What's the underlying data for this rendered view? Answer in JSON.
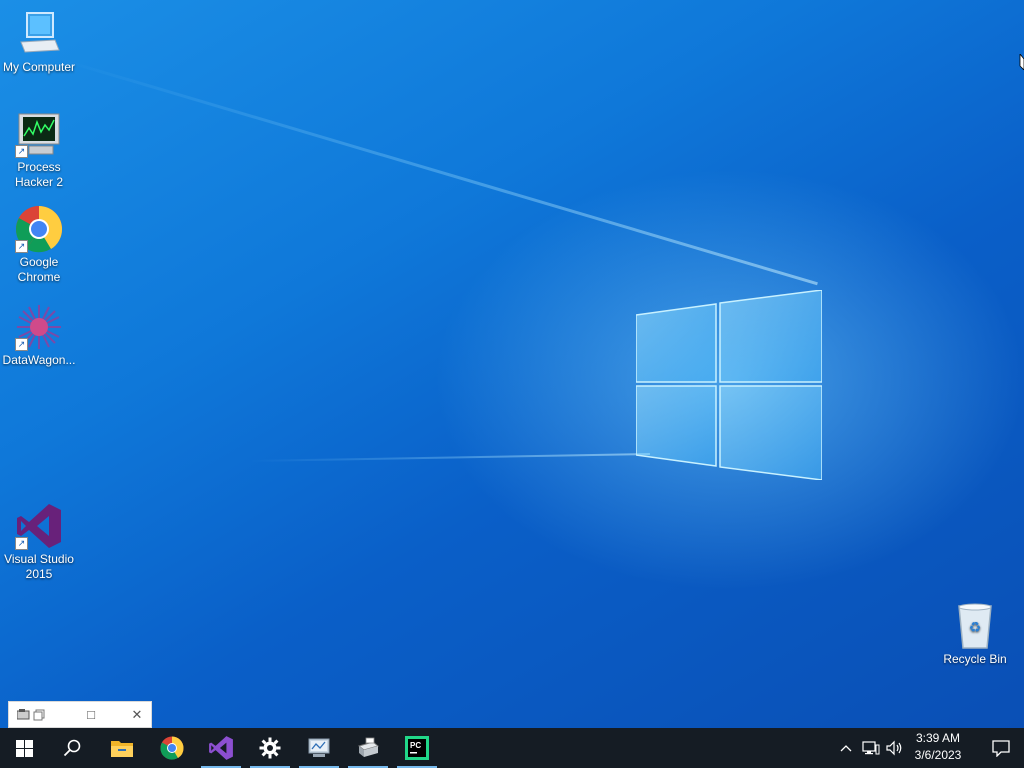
{
  "desktop": {
    "icons": [
      {
        "label": "My Computer"
      },
      {
        "label": "Process Hacker 2"
      },
      {
        "label": "Google Chrome"
      },
      {
        "label": "DataWagon..."
      },
      {
        "label": "Visual Studio 2015"
      },
      {
        "label": "Recycle Bin"
      }
    ]
  },
  "mini_window": {
    "restore_glyph": "□",
    "close_glyph": "✕"
  },
  "taskbar": {
    "clock_time": "3:39 AM",
    "clock_date": "3/6/2023",
    "pinned": [
      {
        "icon": "windows-start-icon"
      },
      {
        "icon": "search-icon"
      },
      {
        "icon": "file-explorer-icon"
      },
      {
        "icon": "chrome-icon"
      },
      {
        "icon": "visual-studio-icon"
      },
      {
        "icon": "settings-gear-icon"
      },
      {
        "icon": "network-app-icon"
      },
      {
        "icon": "printer-app-icon"
      },
      {
        "icon": "pycharm-icon"
      }
    ],
    "pycharm_text": "PC"
  },
  "colors": {
    "taskbar_bg": "#151c24",
    "desktop_blue": "#0f78d9",
    "accent": "#76b9ed"
  }
}
